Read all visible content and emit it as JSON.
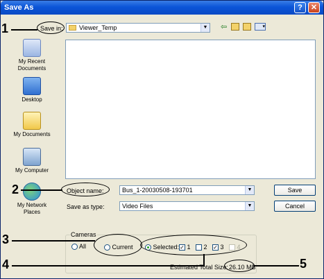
{
  "titlebar": {
    "title": "Save As",
    "help_label": "?",
    "close_label": "✕"
  },
  "save_in": {
    "label": "Save in:",
    "value": "Viewer_Temp"
  },
  "toolbar": [
    "back-icon",
    "up-folder-icon",
    "new-folder-icon",
    "view-menu-icon"
  ],
  "places": [
    {
      "label": "My Recent Documents",
      "icon": "recent-documents-icon"
    },
    {
      "label": "Desktop",
      "icon": "desktop-icon"
    },
    {
      "label": "My Documents",
      "icon": "my-documents-icon"
    },
    {
      "label": "My Computer",
      "icon": "my-computer-icon"
    },
    {
      "label": "My Network Places",
      "icon": "network-places-icon"
    }
  ],
  "object_name": {
    "label": "Object name:",
    "value": "Bus_1-20030508-193701"
  },
  "save_as_type": {
    "label": "Save as type:",
    "value": "Video Files"
  },
  "buttons": {
    "save": "Save",
    "cancel": "Cancel"
  },
  "cameras": {
    "legend": "Cameras",
    "all_label": "All",
    "current_label": "Current",
    "selected_label": "Selected:",
    "selected_mode": "Selected",
    "checkboxes": [
      {
        "label": "1",
        "checked": true,
        "enabled": true
      },
      {
        "label": "2",
        "checked": false,
        "enabled": true
      },
      {
        "label": "3",
        "checked": true,
        "enabled": true
      },
      {
        "label": "4",
        "checked": false,
        "enabled": false
      }
    ]
  },
  "estimated_size": {
    "label": "Estimated Total Size:",
    "value": "26.10 MB"
  },
  "callouts": [
    "1",
    "2",
    "3",
    "4",
    "5"
  ]
}
